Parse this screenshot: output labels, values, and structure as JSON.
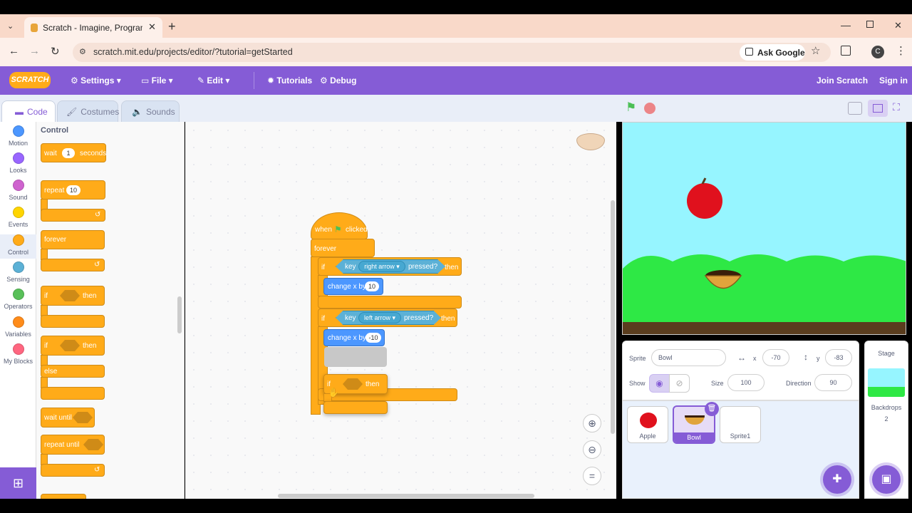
{
  "browser": {
    "tab_title": "Scratch - Imagine, Program, Sha",
    "url": "scratch.mit.edu/projects/editor/?tutorial=getStarted",
    "ask_google": "Ask Google",
    "profile_initial": "C"
  },
  "menubar": {
    "logo": "SCRATCH",
    "settings": "Settings",
    "file": "File",
    "edit": "Edit",
    "tutorials": "Tutorials",
    "debug": "Debug",
    "join": "Join Scratch",
    "signin": "Sign in"
  },
  "editor_tabs": {
    "code": "Code",
    "costumes": "Costumes",
    "sounds": "Sounds"
  },
  "categories": [
    {
      "label": "Motion",
      "color": "#4c97ff"
    },
    {
      "label": "Looks",
      "color": "#9966ff"
    },
    {
      "label": "Sound",
      "color": "#cf63cf"
    },
    {
      "label": "Events",
      "color": "#ffd500"
    },
    {
      "label": "Control",
      "color": "#ffab19"
    },
    {
      "label": "Sensing",
      "color": "#5cb1d6"
    },
    {
      "label": "Operators",
      "color": "#59c059"
    },
    {
      "label": "Variables",
      "color": "#ff8c1a"
    },
    {
      "label": "My Blocks",
      "color": "#ff6680"
    }
  ],
  "palette": {
    "heading": "Control",
    "wait": "wait",
    "wait_value": "1",
    "seconds": "seconds",
    "repeat": "repeat",
    "repeat_value": "10",
    "forever": "forever",
    "if": "if",
    "then": "then",
    "else": "else",
    "wait_until": "wait until",
    "repeat_until": "repeat until"
  },
  "script": {
    "when": "when",
    "clicked": "clicked",
    "forever": "forever",
    "if": "if",
    "then": "then",
    "key": "key",
    "right_arrow": "right arrow",
    "left_arrow": "left arrow",
    "pressed": "pressed?",
    "change_x_by": "change x by",
    "right_value": "10",
    "left_value": "-10"
  },
  "sprite_info": {
    "sprite_label": "Sprite",
    "sprite_name": "Bowl",
    "x_label": "x",
    "x_value": "-70",
    "y_label": "y",
    "y_value": "-83",
    "show_label": "Show",
    "size_label": "Size",
    "size_value": "100",
    "direction_label": "Direction",
    "direction_value": "90"
  },
  "sprites": [
    {
      "name": "Apple"
    },
    {
      "name": "Bowl"
    },
    {
      "name": "Sprite1"
    }
  ],
  "stage_panel": {
    "title": "Stage",
    "backdrops_label": "Backdrops",
    "backdrops_count": "2"
  },
  "colors": {
    "scratch_purple": "#855cd6",
    "control": "#ffab19",
    "sensing": "#5cb1d6",
    "motion": "#4c97ff"
  }
}
